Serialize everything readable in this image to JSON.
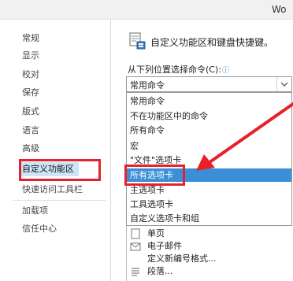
{
  "window": {
    "title": "Wo"
  },
  "nav": {
    "items": [
      {
        "label": "常规"
      },
      {
        "label": "显示"
      },
      {
        "label": "校对"
      },
      {
        "label": "保存"
      },
      {
        "label": "版式"
      },
      {
        "label": "语言"
      },
      {
        "label": "高级"
      },
      {
        "label": "自定义功能区",
        "selected": true
      },
      {
        "label": "快速访问工具栏"
      },
      {
        "label": "加载项"
      },
      {
        "label": "信任中心"
      }
    ]
  },
  "header": {
    "text": "自定义功能区和键盘快捷键。",
    "icon": "customize-ribbon-icon"
  },
  "choose": {
    "label": "从下列位置选择命令(C):",
    "info_icon": "ⓘ",
    "selected_value": "常用命令",
    "options": [
      "常用命令",
      "不在功能区中的命令",
      "所有命令",
      "宏",
      "\"文件\"选项卡",
      "所有选项卡",
      "主选项卡",
      "工具选项卡",
      "自定义选项卡和组"
    ],
    "highlighted_index": 5
  },
  "commands": [
    {
      "label": "单页",
      "icon": "page-icon"
    },
    {
      "label": "电子邮件",
      "icon": "email-icon"
    },
    {
      "label": "定义新编号格式...",
      "icon": ""
    },
    {
      "label": "段落...",
      "icon": "paragraph-icon"
    }
  ],
  "colors": {
    "annotation_red": "#e8202a",
    "highlight_blue": "#3a8fd6",
    "nav_selected": "#cde6f7"
  }
}
